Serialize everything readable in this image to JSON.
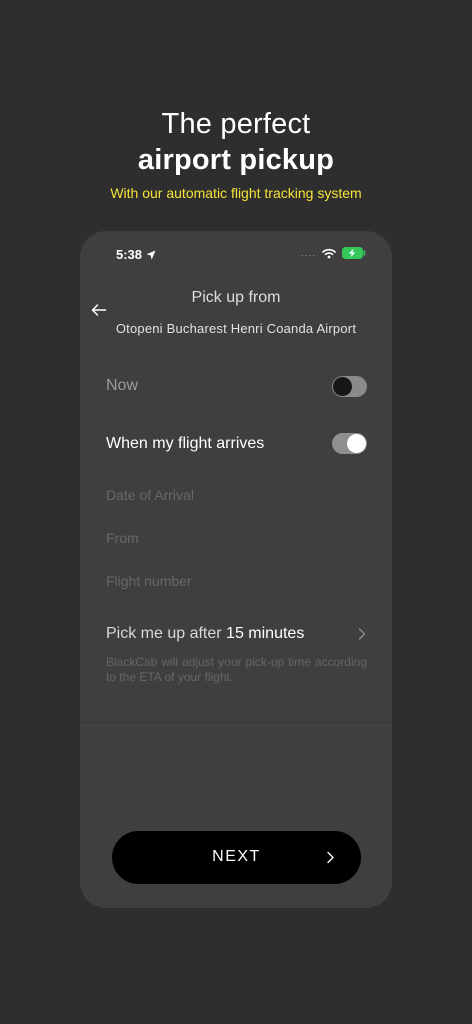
{
  "hero": {
    "title": "The perfect",
    "title_strong": "airport pickup",
    "subtitle": "With our automatic flight tracking system",
    "subtitle_color": "#f6e33a"
  },
  "status_bar": {
    "time": "5:38",
    "icons": [
      "location-arrow-icon",
      "signal-dots-icon",
      "wifi-icon",
      "battery-charging-icon"
    ],
    "dots": "....",
    "battery_color": "#34c759"
  },
  "header": {
    "back_icon": "back-arrow-icon",
    "title": "Pick up from",
    "location": "Otopeni Bucharest Henri Coanda Airport"
  },
  "options": {
    "now_label": "Now",
    "now_enabled": false,
    "flight_label": "When my flight arrives",
    "flight_enabled": true
  },
  "fields": {
    "date_placeholder": "Date of Arrival",
    "from_placeholder": "From",
    "flight_number_placeholder": "Flight number"
  },
  "pickup": {
    "prefix": "Pick me up after ",
    "value": "15 minutes",
    "chevron_icon": "chevron-right-icon"
  },
  "note": "BlackCab will adjust your pick-up time according to the ETA of your flight.",
  "footer": {
    "next_label": "NEXT",
    "next_icon": "chevron-right-icon"
  }
}
